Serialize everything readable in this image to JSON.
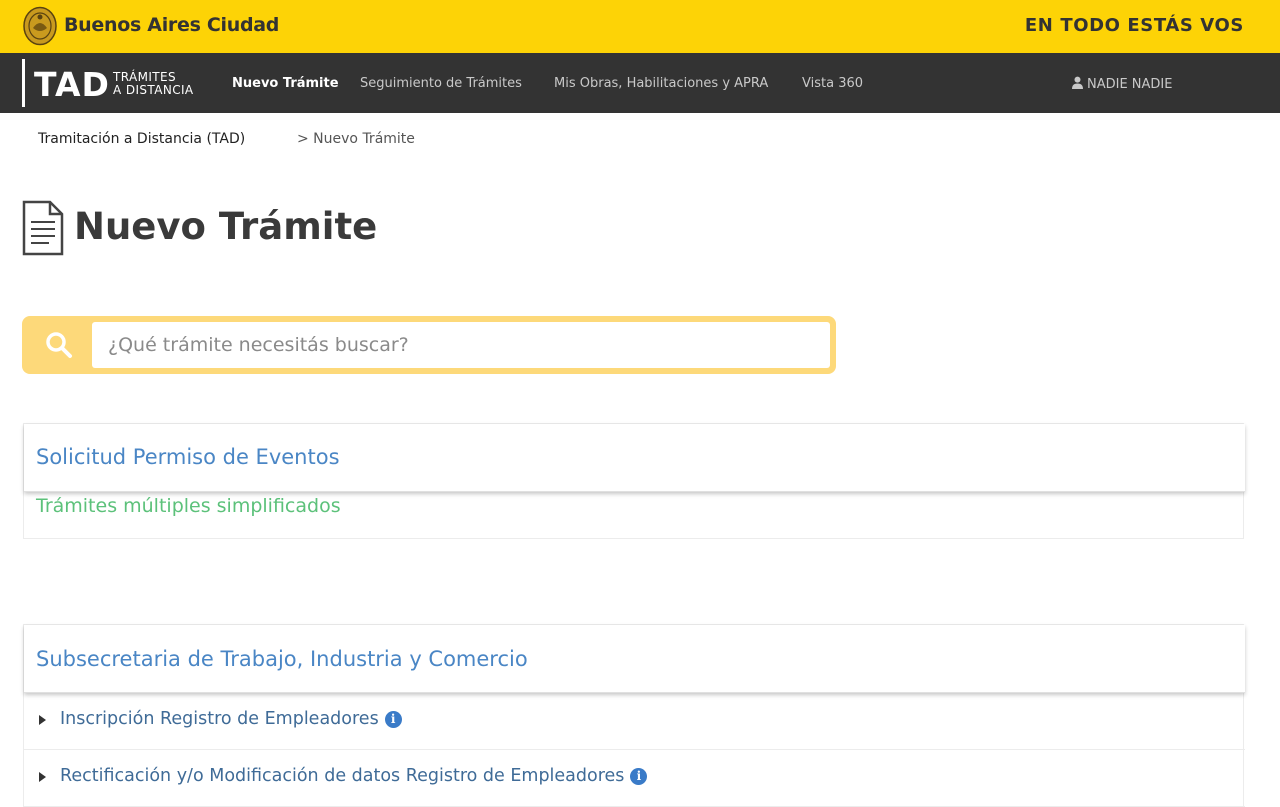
{
  "header": {
    "brand": "Buenos Aires Ciudad",
    "slogan": "EN TODO ESTÁS VOS",
    "seal_icon": "city-seal-icon"
  },
  "nav": {
    "logo": "TAD",
    "logo_sub_1": "TRÁMITES",
    "logo_sub_2": "A DISTANCIA",
    "items": [
      {
        "label": "Nuevo Trámite",
        "active": true
      },
      {
        "label": "Seguimiento de Trámites",
        "active": false
      },
      {
        "label": "Mis Obras, Habilitaciones y APRA",
        "active": false
      },
      {
        "label": "Vista 360",
        "active": false
      }
    ],
    "user": "NADIE NADIE"
  },
  "breadcrumb": {
    "home": "Tramitación a Distancia (TAD)",
    "current": "> Nuevo Trámite"
  },
  "page": {
    "title": "Nuevo Trámite"
  },
  "search": {
    "placeholder": "¿Qué trámite necesitás buscar?",
    "value": ""
  },
  "cards": [
    {
      "title": "Solicitud Permiso de Eventos",
      "subtitle": "Trámites múltiples simplificados"
    },
    {
      "title": "Subsecretaria de Trabajo, Industria y Comercio",
      "items": [
        {
          "label": "Inscripción Registro de Empleadores"
        },
        {
          "label": "Rectificación y/o Modificación de datos Registro de Empleadores"
        }
      ]
    }
  ],
  "colors": {
    "yellow": "#fdd306",
    "nav_dark": "#333333",
    "link_blue": "#4a86c5",
    "green": "#5cc17a"
  }
}
